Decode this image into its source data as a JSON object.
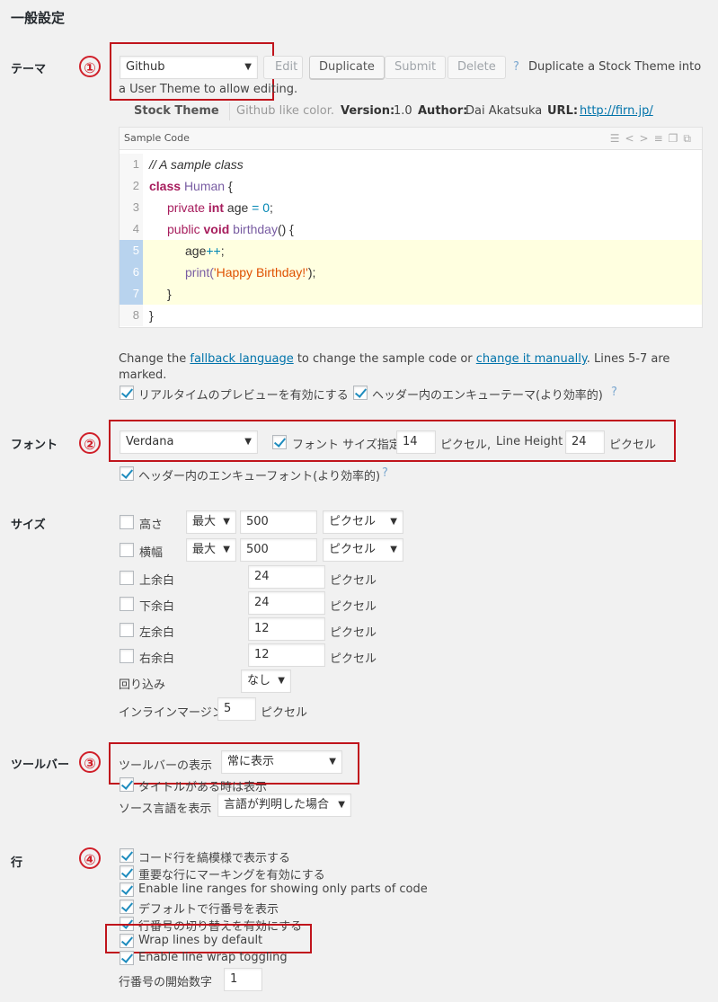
{
  "page": {
    "title": "一般設定"
  },
  "markers": [
    "①",
    "②",
    "③",
    "④"
  ],
  "theme": {
    "label": "テーマ",
    "select_value": "Github",
    "buttons": {
      "edit": "Edit",
      "duplicate": "Duplicate",
      "submit": "Submit",
      "delete": "Delete"
    },
    "help": "?",
    "hint_line1": "Duplicate a Stock Theme into",
    "hint_line2": "a User Theme to allow editing.",
    "info": {
      "type": "Stock Theme",
      "description": "Github like color.",
      "version_label": "Version:",
      "version": "1.0",
      "author_label": "Author:",
      "author": "Dai Akatsuka",
      "url_label": "URL:",
      "url": "http://firn.jp/"
    },
    "sample": {
      "header": "Sample Code",
      "lines": [
        {
          "num": "1",
          "text": "// A sample class"
        },
        {
          "num": "2",
          "text": "class Human {"
        },
        {
          "num": "3",
          "text": "private int age = 0;"
        },
        {
          "num": "4",
          "text": "public void birthday() {"
        },
        {
          "num": "5",
          "text": "age++;"
        },
        {
          "num": "6",
          "text": "print('Happy Birthday!');"
        },
        {
          "num": "7",
          "text": "}"
        },
        {
          "num": "8",
          "text": "}"
        }
      ],
      "tokens": {
        "comment": "// A sample class",
        "class_kw": "class",
        "class_name": "Human",
        "brace_open": "{",
        "private": "private",
        "int": "int",
        "age": "age",
        "eq": "=",
        "zero": "0",
        "semi": ";",
        "public": "public",
        "void": "void",
        "birthday": "birthday",
        "parens": "() {",
        "age2": "age",
        "inc": "++",
        "semi2": ";",
        "print": "print(",
        "string": "'Happy Birthday!'",
        "close_print": ");",
        "brace_close": "}"
      }
    },
    "note_prefix": "Change the ",
    "note_link1": "fallback language",
    "note_mid": " to change the sample code or ",
    "note_link2": "change it manually",
    "note_suffix": ". Lines 5-7 are",
    "note_line2": "marked.",
    "cb_realtime": "リアルタイムのプレビューを有効にする",
    "cb_header_theme": "ヘッダー内のエンキューテーマ(より効率的)"
  },
  "font": {
    "label": "フォント",
    "select_value": "Verdana",
    "cb_size": "フォント サイズ指定",
    "size_value": "14",
    "unit1": "ピクセル,",
    "line_height_label": "Line Height",
    "line_height_value": "24",
    "unit2": "ピクセル",
    "cb_header_font": "ヘッダー内のエンキューフォント(より効率的)"
  },
  "size": {
    "label": "サイズ",
    "height_label": "高さ",
    "height_mode": "最大",
    "height_value": "500",
    "height_unit": "ピクセル",
    "width_label": "横幅",
    "width_mode": "最大",
    "width_value": "500",
    "width_unit": "ピクセル",
    "top_label": "上余白",
    "top_value": "24",
    "bottom_label": "下余白",
    "bottom_value": "24",
    "left_label": "左余白",
    "left_value": "12",
    "right_label": "右余白",
    "right_value": "12",
    "px": "ピクセル",
    "wrap_label": "回り込み",
    "wrap_value": "なし",
    "inline_label": "インラインマージン",
    "inline_value": "5",
    "inline_unit": "ピクセル"
  },
  "toolbar": {
    "label": "ツールバー",
    "show_label": "ツールバーの表示",
    "show_value": "常に表示",
    "cb_title": "タイトルがある時は表示",
    "lang_label": "ソース言語を表示",
    "lang_value": "言語が判明した場合"
  },
  "lines": {
    "label": "行",
    "cb1": "コード行を縞模様で表示する",
    "cb2": "重要な行にマーキングを有効にする",
    "cb3": "Enable line ranges for showing only parts of code",
    "cb4": "デフォルトで行番号を表示",
    "cb5": "行番号の切り替えを有効にする",
    "cb6": "Wrap lines by default",
    "cb7": "Enable line wrap toggling",
    "start_label": "行番号の開始数字",
    "start_value": "1"
  }
}
